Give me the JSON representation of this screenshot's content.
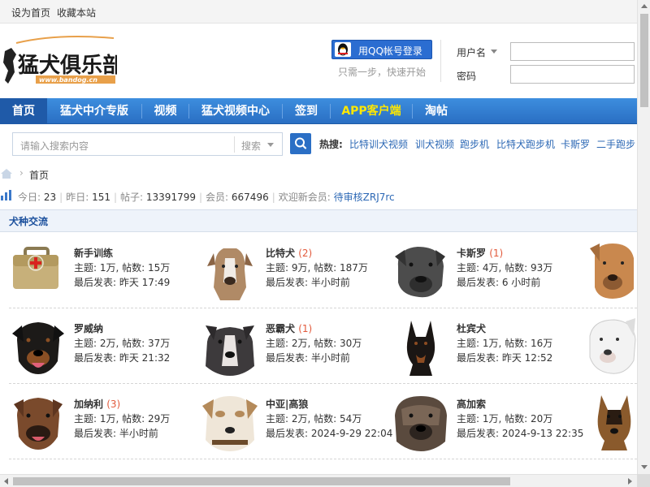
{
  "topbar": {
    "set_home": "设为首页",
    "bookmark": "收藏本站"
  },
  "header": {
    "logo_text": "猛犬俱乐部",
    "logo_url": "www.bandog.cn",
    "qq_login": "用QQ帐号登录",
    "qq_tip": "只需一步，快速开始",
    "username_label": "用户名",
    "password_label": "密码"
  },
  "nav": {
    "items": [
      {
        "label": "首页",
        "active": true
      },
      {
        "label": "猛犬中介专版"
      },
      {
        "label": "视频"
      },
      {
        "label": "猛犬视频中心"
      },
      {
        "label": "签到"
      },
      {
        "label": "APP客户端",
        "highlight": true
      },
      {
        "label": "淘帖"
      }
    ]
  },
  "search": {
    "placeholder": "请输入搜索内容",
    "type": "搜索",
    "hot_label": "热搜:",
    "hot": [
      "比特训犬视频",
      "训犬视频",
      "跑步机",
      "比特犬跑步机",
      "卡斯罗",
      "二手跑步"
    ]
  },
  "breadcrumb": {
    "home": "首页"
  },
  "stats": {
    "today_label": "今日:",
    "today": "23",
    "yesterday_label": "昨日:",
    "yesterday": "151",
    "posts_label": "帖子:",
    "posts": "13391799",
    "members_label": "会员:",
    "members": "667496",
    "newest_label": "欢迎新会员:",
    "newest": "待审核ZRJ7rc"
  },
  "section": {
    "title": "犬种交流",
    "forums": [
      {
        "name": "新手训练",
        "new": "",
        "topics": "主题: 1万, 帖数: 15万",
        "last": "最后发表: 昨天 17:49"
      },
      {
        "name": "比特犬",
        "new": "(2)",
        "topics": "主题: 9万, 帖数: 187万",
        "last": "最后发表: 半小时前"
      },
      {
        "name": "卡斯罗",
        "new": "(1)",
        "topics": "主题: 4万, 帖数: 93万",
        "last": "最后发表: 6 小时前"
      },
      {
        "name": "罗威纳",
        "new": "",
        "topics": "主题: 2万, 帖数: 37万",
        "last": "最后发表: 昨天 21:32"
      },
      {
        "name": "恶霸犬",
        "new": "(1)",
        "topics": "主题: 2万, 帖数: 30万",
        "last": "最后发表: 半小时前"
      },
      {
        "name": "杜宾犬",
        "new": "",
        "topics": "主题: 1万, 帖数: 16万",
        "last": "最后发表: 昨天 12:52"
      },
      {
        "name": "加纳利",
        "new": "(3)",
        "topics": "主题: 1万, 帖数: 29万",
        "last": "最后发表: 半小时前"
      },
      {
        "name": "中亚|高狼",
        "new": "",
        "topics": "主题: 2万, 帖数: 54万",
        "last": "最后发表: 2024-9-29 22:04"
      },
      {
        "name": "高加索",
        "new": "",
        "topics": "主题: 1万, 帖数: 20万",
        "last": "最后发表: 2024-9-13 22:35"
      }
    ]
  },
  "colors": {
    "nav_blue": "#2a6fc3",
    "link_blue": "#2c68b5",
    "new_count": "#e25a3c",
    "section_title": "#1a4f9c"
  }
}
